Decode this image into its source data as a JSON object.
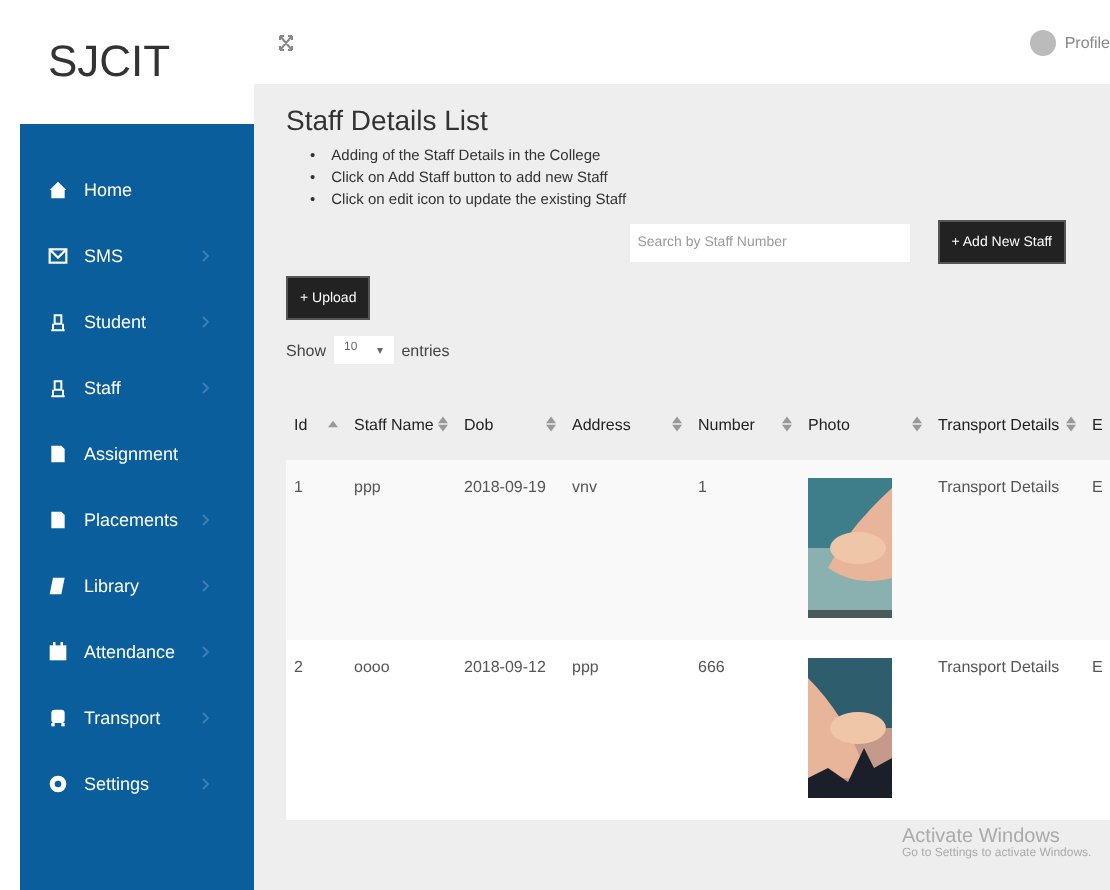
{
  "brand": "SJCIT",
  "topbar": {
    "profile": "Profile"
  },
  "sidebar": {
    "items": [
      {
        "label": "Home",
        "submenu": false
      },
      {
        "label": "SMS",
        "submenu": true
      },
      {
        "label": "Student",
        "submenu": true
      },
      {
        "label": "Staff",
        "submenu": true
      },
      {
        "label": "Assignment",
        "submenu": false
      },
      {
        "label": "Placements",
        "submenu": true
      },
      {
        "label": "Library",
        "submenu": true
      },
      {
        "label": "Attendance",
        "submenu": true
      },
      {
        "label": "Transport",
        "submenu": true
      },
      {
        "label": "Settings",
        "submenu": true
      }
    ]
  },
  "page": {
    "title": "Staff Details List",
    "bullet": "•",
    "notes": [
      "Adding of the Staff Details in the College",
      "Click on Add Staff button to add new Staff",
      "Click on edit icon to update the existing Staff"
    ],
    "search": {
      "placeholder": "Search by Staff Number"
    },
    "add_button": "+ Add New Staff",
    "upload_button": "+ Upload",
    "length": {
      "before": "Show",
      "value": "10",
      "caret": "▾",
      "after": "entries"
    }
  },
  "table": {
    "columns": [
      {
        "label": "Id",
        "sorted": true
      },
      {
        "label": "Staff Name",
        "sorted": false
      },
      {
        "label": "Dob",
        "sorted": false
      },
      {
        "label": "Address",
        "sorted": false
      },
      {
        "label": "Number",
        "sorted": false
      },
      {
        "label": "Photo",
        "sorted": false
      },
      {
        "label": "Transport Details",
        "sorted": false
      },
      {
        "label": "E"
      }
    ],
    "rows": [
      {
        "cells": [
          "1",
          "ppp",
          "2018-09-19",
          "vnv",
          "1",
          {
            "kind": "picture"
          },
          "Transport Details",
          "E"
        ]
      },
      {
        "cells": [
          "2",
          "oooo",
          "2018-09-12",
          "ppp",
          "666",
          {
            "kind": "picture"
          },
          "Transport Details",
          "E"
        ]
      }
    ]
  },
  "os_notice": {
    "title": "Activate Windows",
    "text": "Go to Settings to activate Windows."
  }
}
